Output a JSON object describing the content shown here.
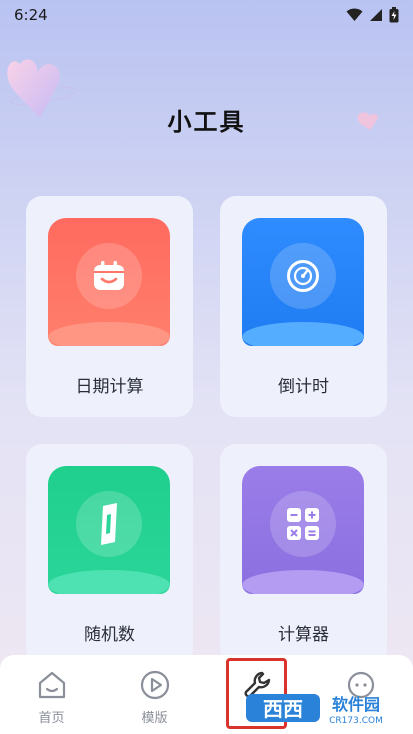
{
  "status_bar": {
    "time": "6:24"
  },
  "page": {
    "title": "小工具"
  },
  "tools": [
    {
      "label": "日期计算",
      "icon": "calendar-icon",
      "color_top": "#ff6a5f",
      "color_bottom": "#ff7f6c",
      "base": "#ff8d7a"
    },
    {
      "label": "倒计时",
      "icon": "gauge-icon",
      "color_top": "#2f8cff",
      "color_bottom": "#1f7bf1",
      "base": "#4aa4ff"
    },
    {
      "label": "随机数",
      "icon": "dice-icon",
      "color_top": "#1fcf8c",
      "color_bottom": "#2bd59a",
      "base": "#45e0ad"
    },
    {
      "label": "计算器",
      "icon": "calculator-icon",
      "color_top": "#9a7de8",
      "color_bottom": "#8b6fe0",
      "base": "#b198f0"
    }
  ],
  "bottom_nav": {
    "items": [
      {
        "label": "首页",
        "icon": "home-icon"
      },
      {
        "label": "模版",
        "icon": "play-icon"
      },
      {
        "label": "",
        "icon": "wrench-icon"
      },
      {
        "label": "",
        "icon": "chat-icon"
      }
    ]
  },
  "watermark": {
    "text": "西西软件园",
    "sub": "CR173.COM"
  }
}
